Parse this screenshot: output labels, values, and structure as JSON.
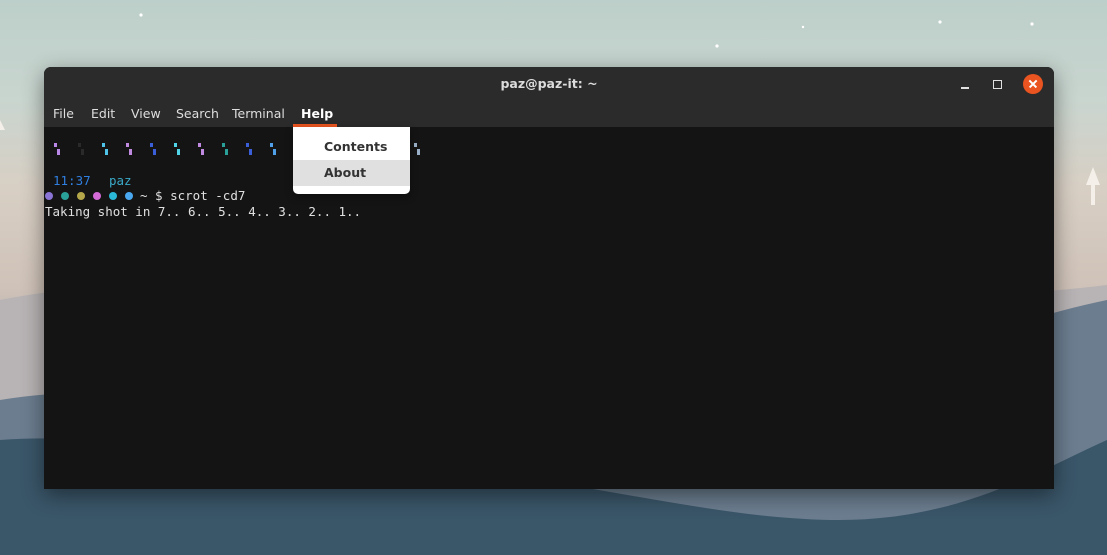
{
  "window": {
    "title": "paz@paz-it: ~"
  },
  "menubar": {
    "items": [
      {
        "label": "File"
      },
      {
        "label": "Edit"
      },
      {
        "label": "View"
      },
      {
        "label": "Search"
      },
      {
        "label": "Terminal"
      },
      {
        "label": "Help"
      }
    ],
    "active": "Help"
  },
  "help_menu": {
    "items": [
      {
        "label": "Contents"
      },
      {
        "label": "About"
      }
    ],
    "hovered": "About"
  },
  "terminal": {
    "prompt_time": "11:37",
    "prompt_user": "paz",
    "prompt_dot_colors": [
      "#8a74d6",
      "#2aa198",
      "#b5a84a",
      "#d36ad6",
      "#2ab8d6",
      "#4aa8f0"
    ],
    "command_prefix": "~ $",
    "command": "scrot -cd7",
    "output": "Taking shot in 7.. 6.. 5.. 4.. 3.. 2.. 1..",
    "glyph_colors": [
      "#b987e6",
      "#2a2a2a",
      "#4fc3e8",
      "#c08ae0",
      "#3a5fd8",
      "#4fd4e8",
      "#c08ae0",
      "#2aa198",
      "#3a5fd8",
      "#4fa0e8",
      "#9ab0c8"
    ]
  },
  "colors": {
    "accent": "#e95420",
    "terminal_bg": "#141414",
    "titlebar_bg": "#2b2b2b"
  }
}
